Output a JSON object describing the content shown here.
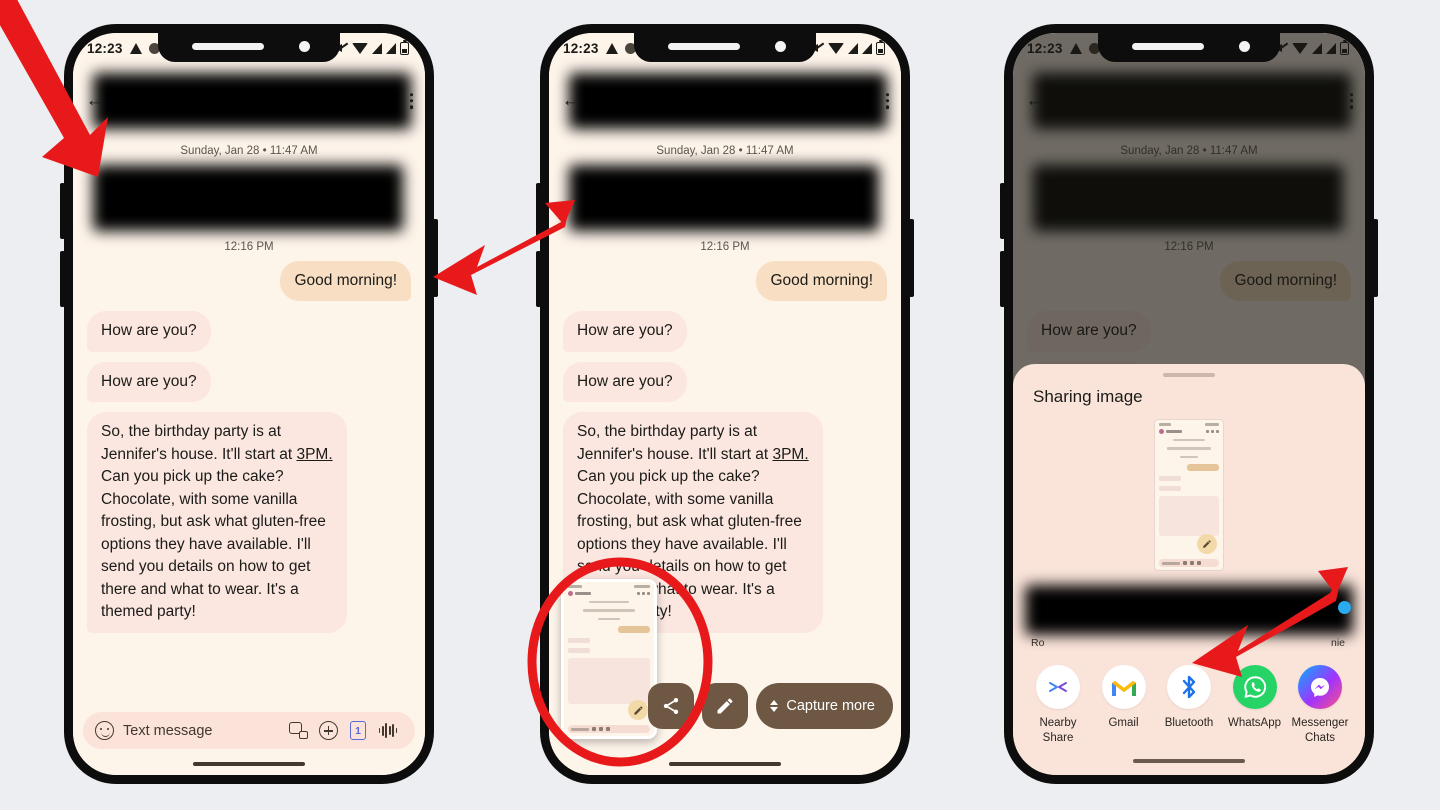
{
  "status_bar": {
    "time": "12:23",
    "id_label": "id",
    "icons": [
      "triangle-icon",
      "circle-icon",
      "id-label",
      "dot-icon",
      "mute-icon",
      "wifi-icon",
      "signal-icon",
      "signal-icon",
      "battery-icon"
    ]
  },
  "conversation": {
    "date_separator": "Sunday, Jan 28 • 11:47 AM",
    "timestamp": "12:16 PM",
    "messages": [
      {
        "side": "out",
        "text": "Good morning!"
      },
      {
        "side": "in",
        "text": "How are you?"
      },
      {
        "side": "in",
        "text": "How are you?"
      }
    ],
    "long_message": {
      "line1": "So, the birthday party is at",
      "line2_pre": "Jennifer's house. It'll start at ",
      "line2_link": "3PM.",
      "line3": "Can you pick up the cake?",
      "line4": "Chocolate, with some vanilla",
      "line5": "frosting, but ask what gluten-free",
      "line6": "options they have available. I'll",
      "line7": "send you details on how to get",
      "line8": "there and what to wear.  It's a",
      "line9": "themed party!"
    }
  },
  "composer": {
    "placeholder": "Text message",
    "sim_badge": "1",
    "icons": [
      "emoji-icon",
      "gallery-icon",
      "plus-icon",
      "sim-icon",
      "voice-waveform-icon"
    ]
  },
  "screenshot_actions": {
    "share_label": "share-icon",
    "edit_label": "edit-pencil-icon",
    "capture_more_label": "Capture more"
  },
  "share_sheet": {
    "title": "Sharing image",
    "contacts": [
      {
        "label": "Ro"
      },
      {
        "label": "nie"
      }
    ],
    "apps": [
      {
        "name": "Nearby Share",
        "icon": "nearby-share-icon",
        "color": "#4285F4"
      },
      {
        "name": "Gmail",
        "icon": "gmail-icon",
        "color": "#EA4335"
      },
      {
        "name": "Bluetooth",
        "icon": "bluetooth-icon",
        "color": "#1A73E8"
      },
      {
        "name": "WhatsApp",
        "icon": "whatsapp-icon",
        "color": "#25D366"
      },
      {
        "name": "Messenger Chats",
        "icon": "messenger-icon",
        "color": "#A334FA"
      }
    ]
  },
  "annotations": {
    "arrow_color": "#E8191B",
    "arrow1": "points-to-power-button-phone1",
    "arrow2": "points-from-phone2-to-phone1",
    "arrow3": "points-to-whatsapp-share-target",
    "highlight_circle": "screenshot-preview-thumbnail"
  },
  "theme": {
    "page_background": "#eceef2",
    "screen_background": "#fdf4ea",
    "bubble_out": "#f8dfc3",
    "bubble_in": "#fbe6e0",
    "composer_background": "#fbe3d9",
    "action_button": "#6e5844",
    "sheet_background": "#fae4da"
  }
}
